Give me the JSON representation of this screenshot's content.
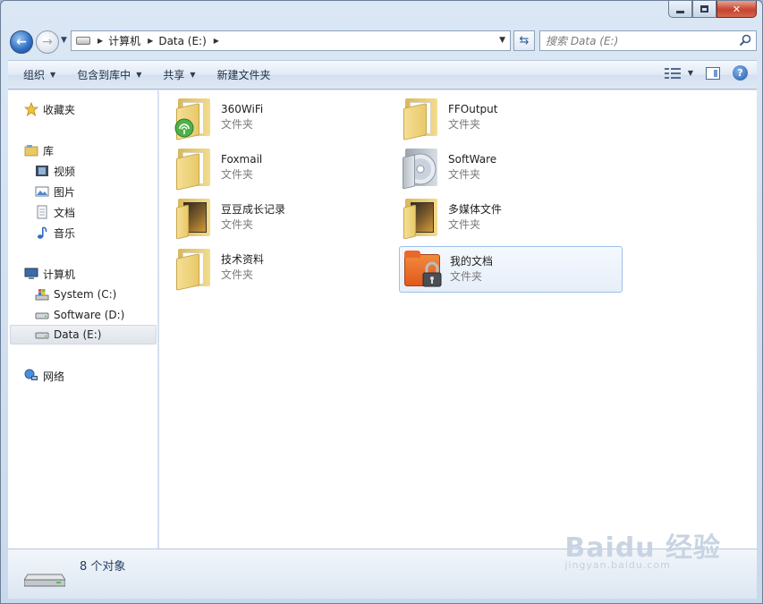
{
  "window": {
    "caption": {
      "minimize": "minimize",
      "maximize": "maximize",
      "close": "✕"
    }
  },
  "nav": {
    "back_icon": "back-arrow-icon",
    "forward_icon": "forward-arrow-icon",
    "breadcrumbs": [
      "计算机",
      "Data (E:)"
    ],
    "search_placeholder": "搜索 Data (E:)"
  },
  "toolbar": {
    "items": [
      {
        "label": "组织",
        "has_menu": true
      },
      {
        "label": "包含到库中",
        "has_menu": true
      },
      {
        "label": "共享",
        "has_menu": true
      },
      {
        "label": "新建文件夹",
        "has_menu": false
      }
    ],
    "help_label": "?"
  },
  "sidebar": {
    "favorites": "收藏夹",
    "libraries": "库",
    "library_items": [
      "视频",
      "图片",
      "文档",
      "音乐"
    ],
    "computer": "计算机",
    "drives": [
      "System (C:)",
      "Software (D:)",
      "Data (E:)"
    ],
    "selected_drive": "Data (E:)",
    "network": "网络"
  },
  "files": [
    {
      "name": "360WiFi",
      "type": "文件夹",
      "icon": "wifi-folder-icon"
    },
    {
      "name": "FFOutput",
      "type": "文件夹",
      "icon": "folder-icon"
    },
    {
      "name": "Foxmail",
      "type": "文件夹",
      "icon": "folder-icon"
    },
    {
      "name": "SoftWare",
      "type": "文件夹",
      "icon": "cd-folder-icon"
    },
    {
      "name": "豆豆成长记录",
      "type": "文件夹",
      "icon": "media-folder-icon"
    },
    {
      "name": "多媒体文件",
      "type": "文件夹",
      "icon": "media-folder-icon"
    },
    {
      "name": "技术资料",
      "type": "文件夹",
      "icon": "folder-icon"
    },
    {
      "name": "我的文档",
      "type": "文件夹",
      "icon": "locked-folder-icon",
      "selected": true
    }
  ],
  "details": {
    "count": "8 个对象"
  },
  "watermark": {
    "main": "Baidu 经验",
    "sub": "jingyan.baidu.com"
  },
  "colors": {
    "accent": "#2c6cc0",
    "selection": "#9dc0e9",
    "chrome": "#dbe7f5"
  }
}
